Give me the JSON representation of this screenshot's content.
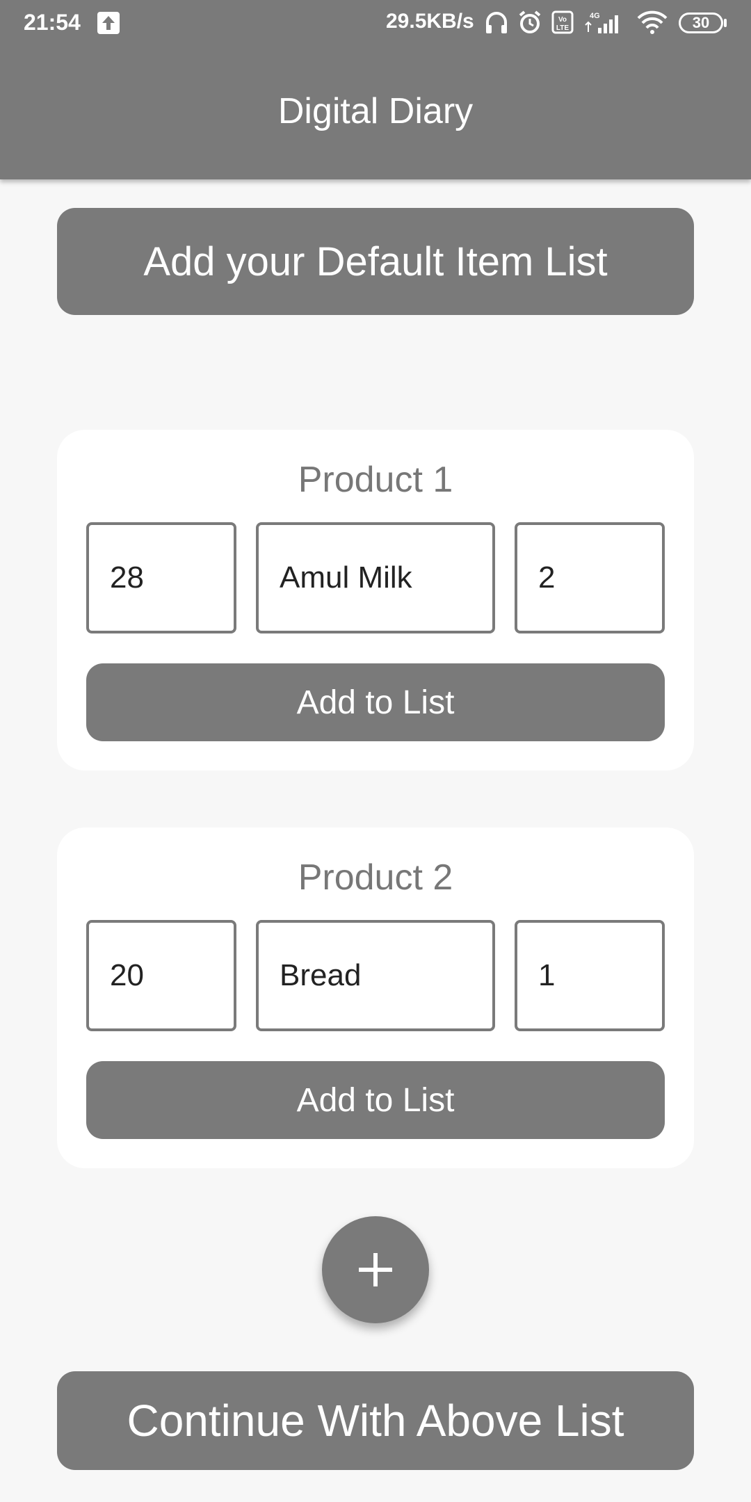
{
  "status_bar": {
    "time": "21:54",
    "network_speed": "29.5KB/s",
    "battery": "30",
    "icons": [
      "upload-icon",
      "headphones-icon",
      "alarm-icon",
      "volte-icon",
      "4g-signal-icon",
      "wifi-icon",
      "battery-icon"
    ]
  },
  "app_bar": {
    "title": "Digital Diary"
  },
  "header_button": {
    "label": "Add your Default Item List"
  },
  "products": [
    {
      "title": "Product 1",
      "price": "28",
      "name": "Amul Milk",
      "quantity": "2",
      "button_label": "Add to List"
    },
    {
      "title": "Product 2",
      "price": "20",
      "name": "Bread",
      "quantity": "1",
      "button_label": "Add to List"
    }
  ],
  "fab": {
    "icon": "plus-icon"
  },
  "footer_button": {
    "label": "Continue With Above List"
  },
  "colors": {
    "primary": "#7a7a7a",
    "background": "#f7f7f7",
    "card": "#ffffff"
  }
}
